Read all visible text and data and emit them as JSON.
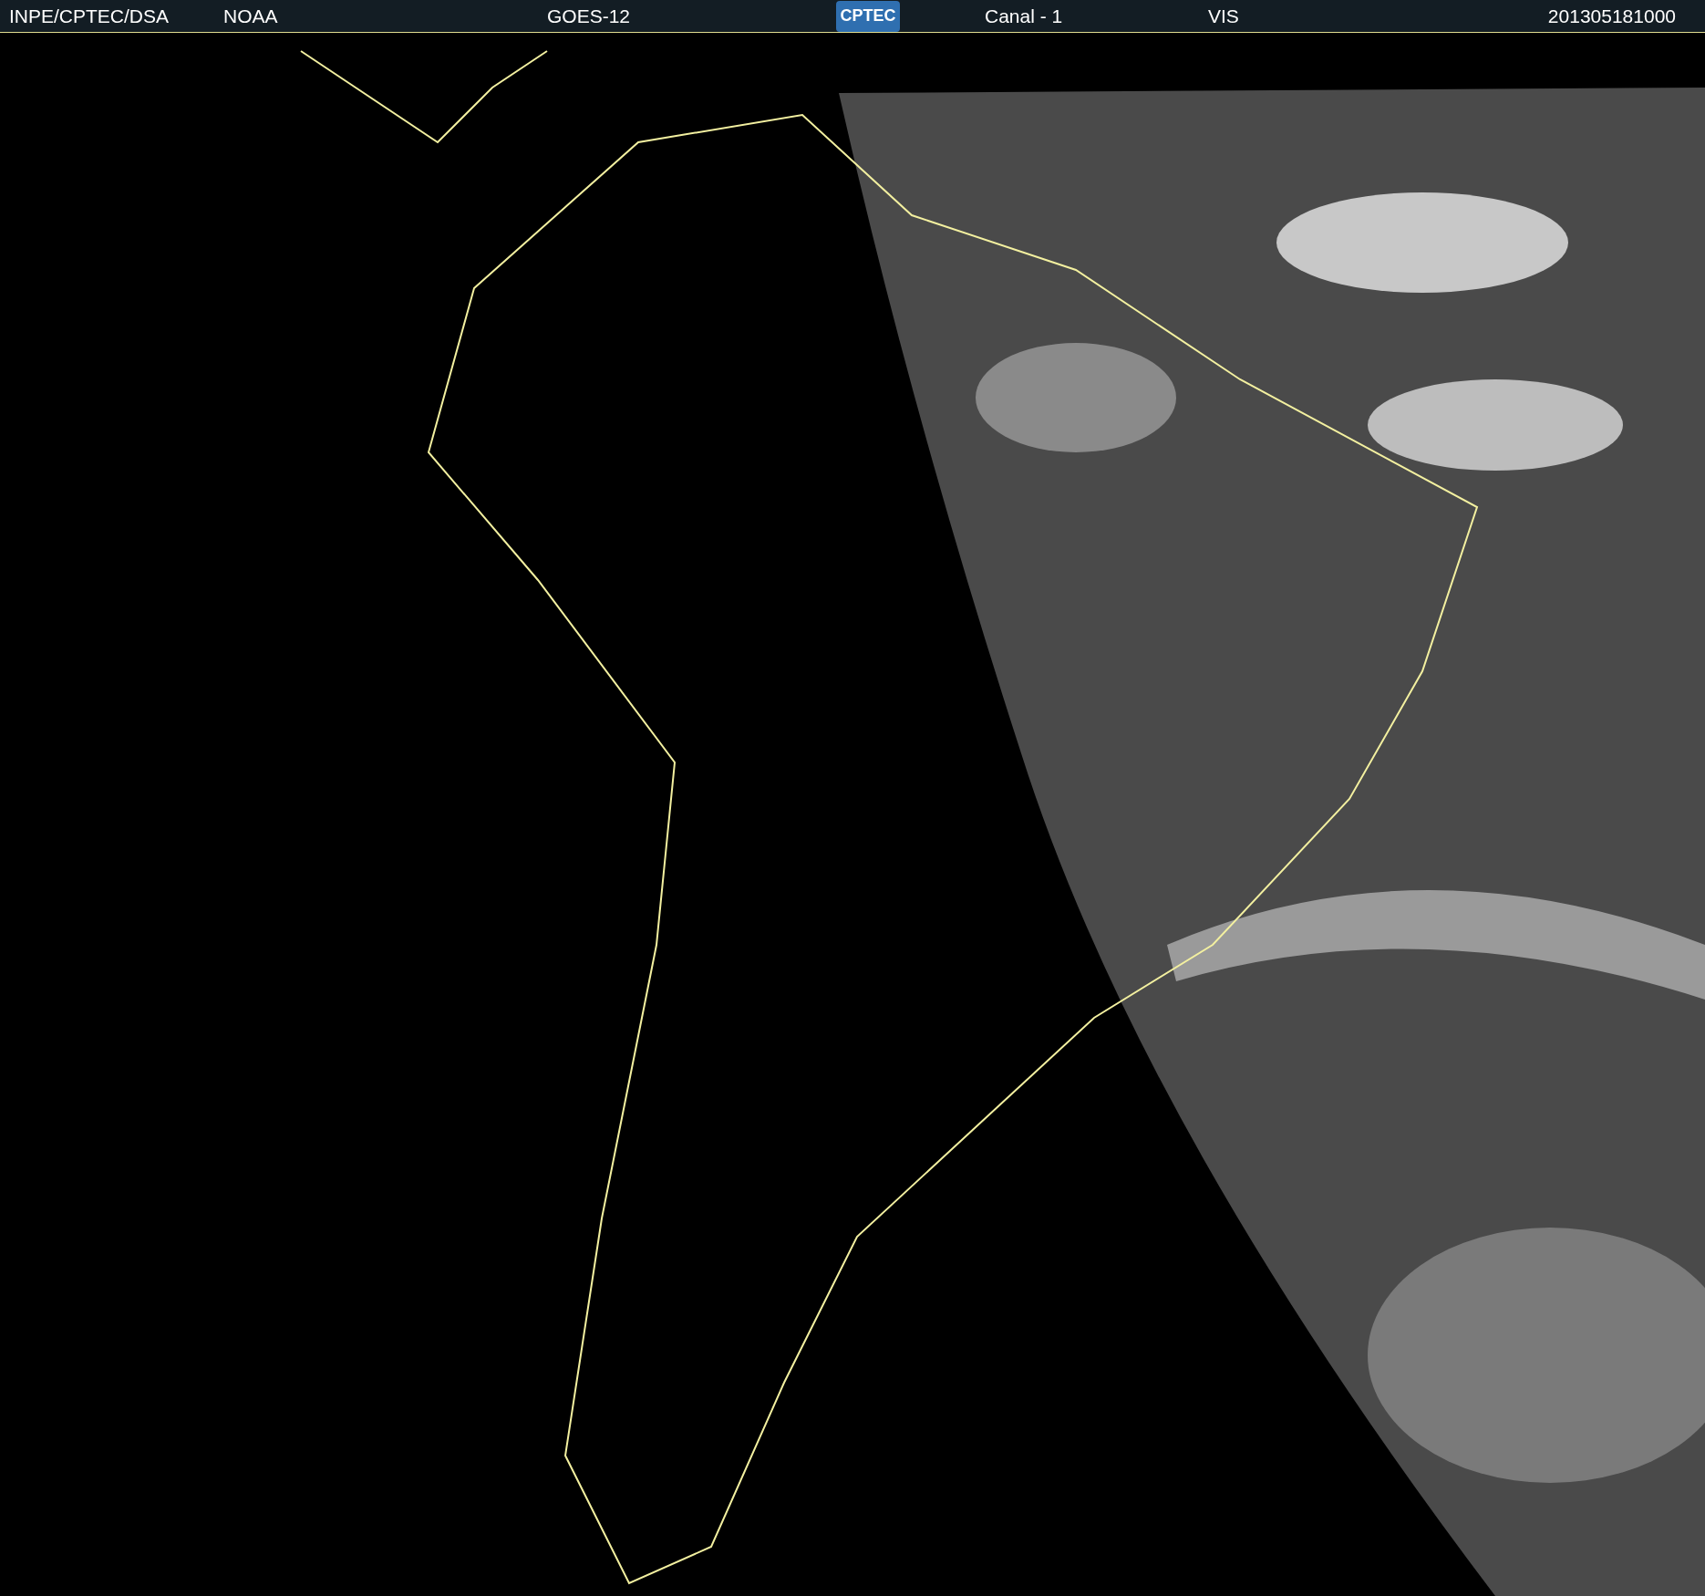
{
  "header": {
    "source": "INPE/CPTEC/DSA",
    "agency": "NOAA",
    "satellite": "GOES-12",
    "logo_text": "CPTEC",
    "channel": "Canal - 1",
    "band": "VIS",
    "timestamp": "201305181000"
  }
}
